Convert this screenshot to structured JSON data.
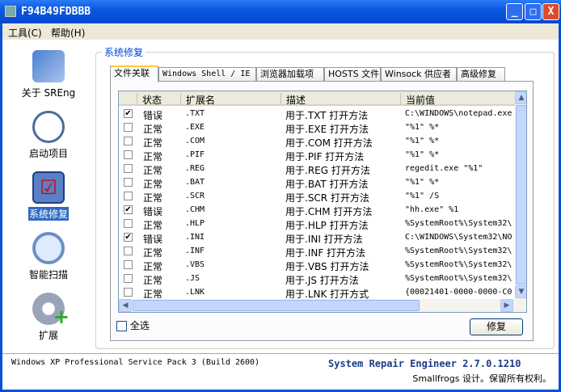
{
  "window": {
    "title": "F94B49FDBBB",
    "minimize": "_",
    "maximize": "□",
    "close": "X"
  },
  "menu": [
    {
      "label": "工具(C)"
    },
    {
      "label": "帮助(H)"
    }
  ],
  "sidebar": [
    {
      "label": "关于 SREng",
      "icon": "about-icon"
    },
    {
      "label": "启动项目",
      "icon": "clock-icon"
    },
    {
      "label": "系统修复",
      "icon": "checklist-icon",
      "selected": true
    },
    {
      "label": "智能扫描",
      "icon": "magnifier-icon"
    },
    {
      "label": "扩展",
      "icon": "gear-plus-icon"
    }
  ],
  "group": {
    "label": "系统修复"
  },
  "tabs": [
    "文件关联",
    "Windows Shell / IE",
    "浏览器加载项",
    "HOSTS 文件",
    "Winsock 供应者",
    "高级修复"
  ],
  "table": {
    "columns": [
      "状态",
      "扩展名",
      "描述",
      "当前值"
    ],
    "rows": [
      {
        "checked": true,
        "status": "错误",
        "ext": ".TXT",
        "desc": "用于.TXT 打开方法",
        "value": "C:\\WINDOWS\\notepad.exe"
      },
      {
        "checked": false,
        "status": "正常",
        "ext": ".EXE",
        "desc": "用于.EXE 打开方法",
        "value": "\"%1\" %*"
      },
      {
        "checked": false,
        "status": "正常",
        "ext": ".COM",
        "desc": "用于.COM 打开方法",
        "value": "\"%1\" %*"
      },
      {
        "checked": false,
        "status": "正常",
        "ext": ".PIF",
        "desc": "用于.PIF 打开方法",
        "value": "\"%1\" %*"
      },
      {
        "checked": false,
        "status": "正常",
        "ext": ".REG",
        "desc": "用于.REG 打开方法",
        "value": "regedit.exe \"%1\""
      },
      {
        "checked": false,
        "status": "正常",
        "ext": ".BAT",
        "desc": "用于.BAT 打开方法",
        "value": "\"%1\" %*"
      },
      {
        "checked": false,
        "status": "正常",
        "ext": ".SCR",
        "desc": "用于.SCR 打开方法",
        "value": "\"%1\" /S"
      },
      {
        "checked": true,
        "status": "错误",
        "ext": ".CHM",
        "desc": "用于.CHM 打开方法",
        "value": "\"hh.exe\" %1"
      },
      {
        "checked": false,
        "status": "正常",
        "ext": ".HLP",
        "desc": "用于.HLP 打开方法",
        "value": "%SystemRoot%\\System32\\"
      },
      {
        "checked": true,
        "status": "错误",
        "ext": ".INI",
        "desc": "用于.INI 打开方法",
        "value": "C:\\WINDOWS\\System32\\NO"
      },
      {
        "checked": false,
        "status": "正常",
        "ext": ".INF",
        "desc": "用于.INF 打开方法",
        "value": "%SystemRoot%\\System32\\"
      },
      {
        "checked": false,
        "status": "正常",
        "ext": ".VBS",
        "desc": "用于.VBS 打开方法",
        "value": "%SystemRoot%\\System32\\"
      },
      {
        "checked": false,
        "status": "正常",
        "ext": ".JS",
        "desc": "用于.JS 打开方法",
        "value": "%SystemRoot%\\System32\\"
      },
      {
        "checked": false,
        "status": "正常",
        "ext": ".LNK",
        "desc": "用于.LNK 打开方式",
        "value": "{00021401-0000-0000-C0"
      }
    ]
  },
  "select_all": "全选",
  "repair_button": "修复",
  "status": {
    "os": "Windows XP Professional Service Pack 3 (Build 2600)",
    "product": "System Repair Engineer 2.7.0.1210",
    "copyright": "Smallfrogs 设计。保留所有权利。"
  },
  "colors": {
    "title_blue": "#0548d0",
    "accent": "#0046d5",
    "selection": "#316ac5"
  }
}
